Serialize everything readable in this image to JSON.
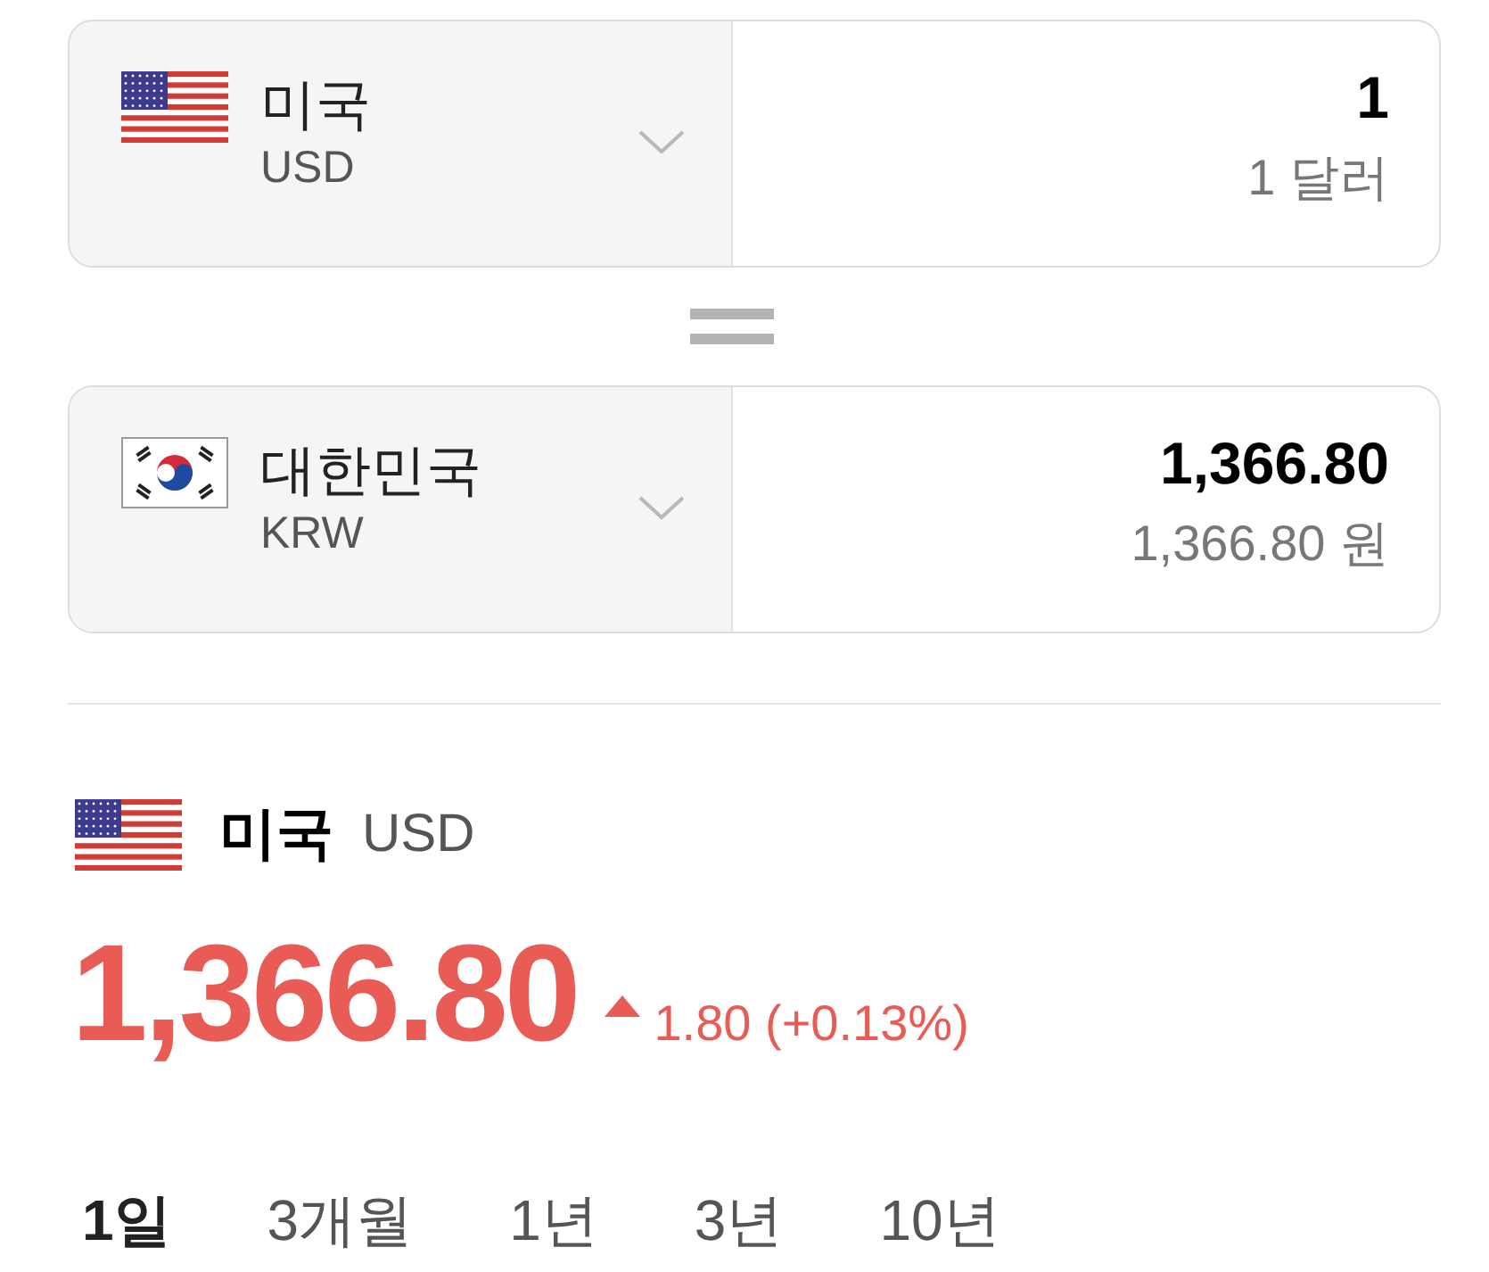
{
  "converter": [
    {
      "kind": "us",
      "country": "미국",
      "code": "USD",
      "amount": "1",
      "amount_words": "1 달러"
    },
    {
      "kind": "kr",
      "country": "대한민국",
      "code": "KRW",
      "amount": "1,366.80",
      "amount_words": "1,366.80 원"
    }
  ],
  "rate": {
    "kind": "us",
    "country": "미국",
    "code": "USD",
    "value": "1,366.80",
    "rising": true,
    "change": "1.80 (+0.13%)"
  },
  "periods": [
    {
      "label": "1일",
      "selected": true
    },
    {
      "label": "3개월",
      "selected": false
    },
    {
      "label": "1년",
      "selected": false
    },
    {
      "label": "3년",
      "selected": false
    },
    {
      "label": "10년",
      "selected": false
    }
  ]
}
